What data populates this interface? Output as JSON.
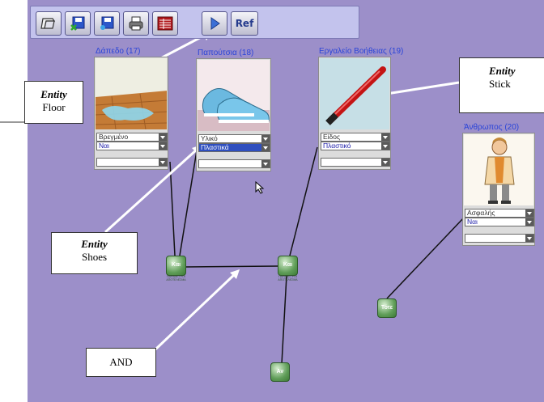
{
  "toolbar": {
    "buttons": [
      {
        "icon": "new-document-icon"
      },
      {
        "icon": "save-icon"
      },
      {
        "icon": "save-as-icon"
      },
      {
        "icon": "print-icon"
      },
      {
        "icon": "table-icon"
      },
      {
        "icon": "play-icon"
      }
    ],
    "ref_label": "Ref"
  },
  "entities": {
    "floor": {
      "title": "Δάπεδο (17)",
      "image_icon": "wet-floor-image",
      "dropdowns": [
        "Βρεγμένο",
        "Ναι",
        ""
      ]
    },
    "shoes": {
      "title": "Παπούτσια (18)",
      "image_icon": "sneakers-image",
      "dropdowns": [
        "Υλικό",
        "Πλαστικά",
        ""
      ]
    },
    "tool": {
      "title": "Εργαλείο Βοήθειας (19)",
      "image_icon": "stick-image",
      "dropdowns": [
        "Είδος",
        "Πλαστικό",
        ""
      ]
    },
    "person": {
      "title": "Άνθρωπος (20)",
      "image_icon": "person-image",
      "dropdowns": [
        "Ασφαλής",
        "Ναι",
        ""
      ]
    }
  },
  "nodes": {
    "and1": {
      "label": "Και",
      "sub": "ΠΑΡΑΜΕΤΡΟΙ ΑΠΟΤΕΛΕΣΜΑ"
    },
    "and2": {
      "label": "Και",
      "sub": "ΠΑΡΑΜΕΤΡΟΙ ΑΠΟΤΕΛΕΣΜΑ"
    },
    "then": {
      "label": "Τότε"
    },
    "if": {
      "label": "Αν"
    }
  },
  "callouts": {
    "floor": {
      "title": "Entity",
      "sub": "Floor"
    },
    "stick": {
      "title": "Entity",
      "sub": "Stick"
    },
    "shoes": {
      "title": "Entity",
      "sub": "Shoes"
    },
    "and": {
      "text": "AND"
    }
  },
  "colors": {
    "canvas": "#9c8fc9",
    "toolbar": "#c3c3ed",
    "entity_title": "#2a44d8",
    "node_green": "#5f9d58"
  }
}
